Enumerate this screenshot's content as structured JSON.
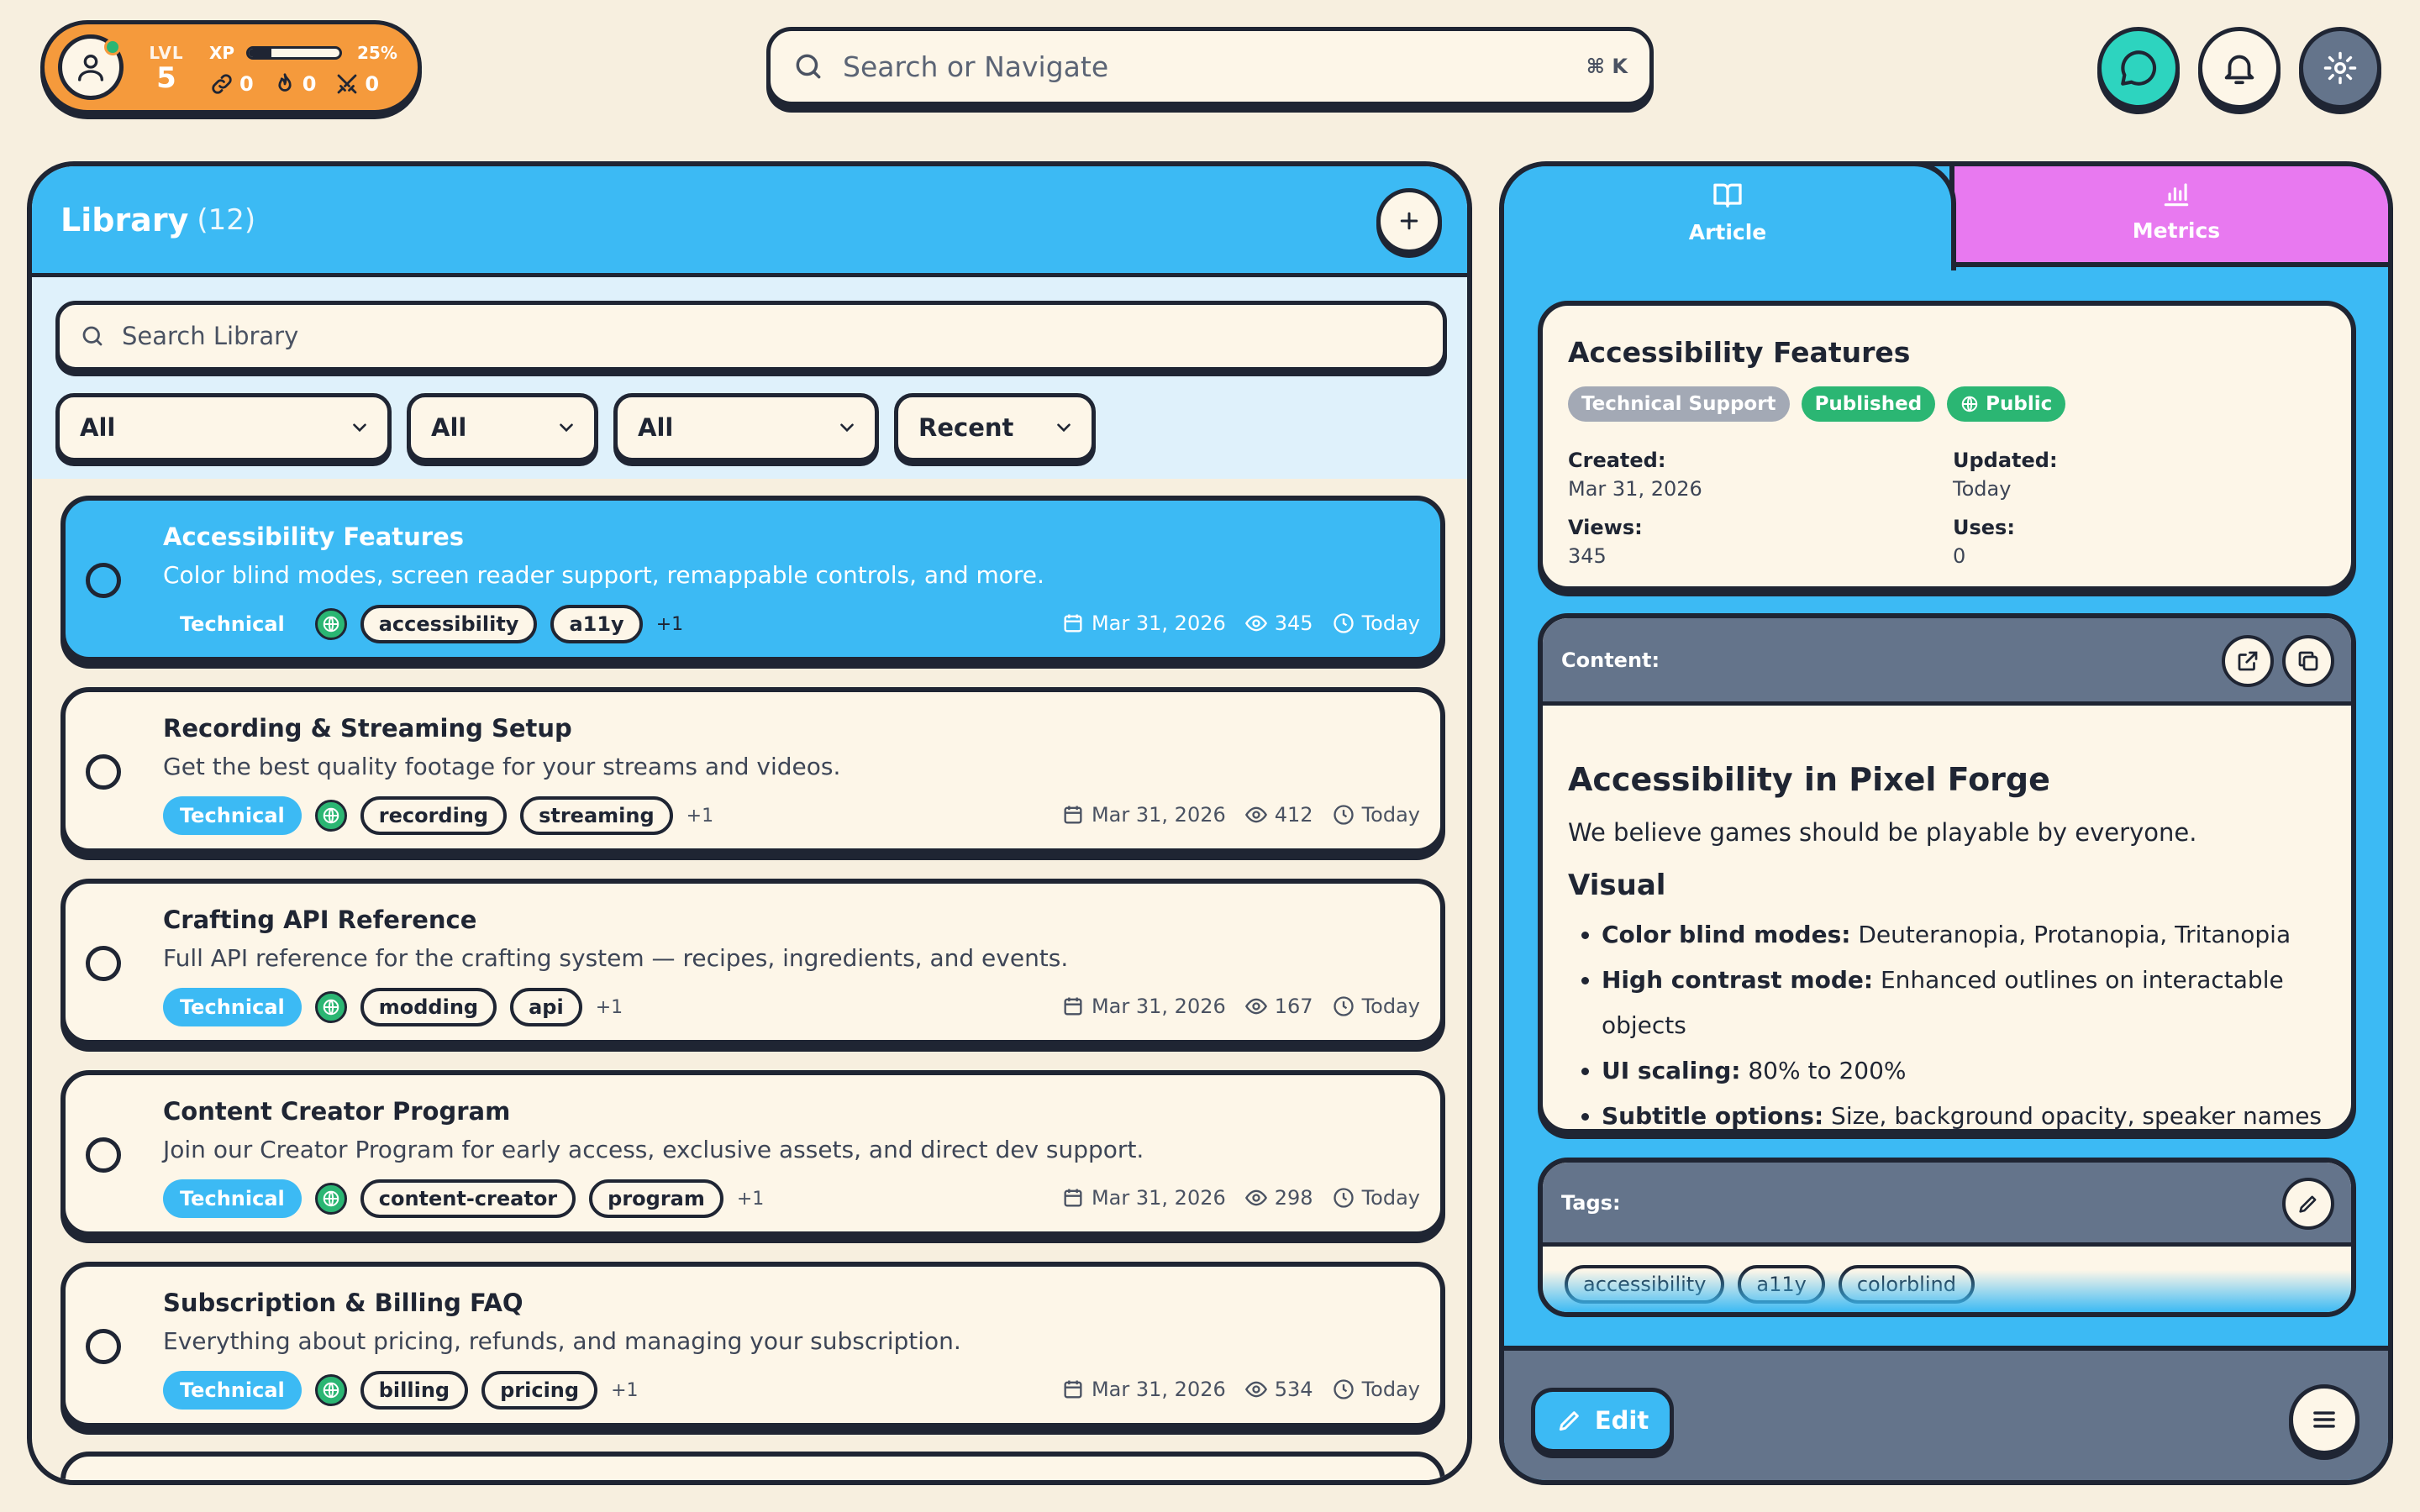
{
  "profile": {
    "level_label": "LVL",
    "level": "5",
    "xp_label": "XP",
    "xp_percent": "25%",
    "xp_fraction": 0.25,
    "stat_links": "0",
    "stat_streak": "0",
    "stat_battles": "0"
  },
  "search": {
    "placeholder": "Search or Navigate",
    "shortcut": "⌘ K"
  },
  "library": {
    "title": "Library",
    "count": "(12)",
    "search_placeholder": "Search Library",
    "filters": [
      "All",
      "All",
      "All",
      "Recent"
    ],
    "items": [
      {
        "title": "Accessibility Features",
        "description": "Color blind modes, screen reader support, remappable controls, and more.",
        "category": "Technical",
        "tags": [
          "accessibility",
          "a11y"
        ],
        "more": "+1",
        "date": "Mar 31, 2026",
        "views": "345",
        "updated": "Today"
      },
      {
        "title": "Recording & Streaming Setup",
        "description": "Get the best quality footage for your streams and videos.",
        "category": "Technical",
        "tags": [
          "recording",
          "streaming"
        ],
        "more": "+1",
        "date": "Mar 31, 2026",
        "views": "412",
        "updated": "Today"
      },
      {
        "title": "Crafting API Reference",
        "description": "Full API reference for the crafting system — recipes, ingredients, and events.",
        "category": "Technical",
        "tags": [
          "modding",
          "api"
        ],
        "more": "+1",
        "date": "Mar 31, 2026",
        "views": "167",
        "updated": "Today"
      },
      {
        "title": "Content Creator Program",
        "description": "Join our Creator Program for early access, exclusive assets, and direct dev support.",
        "category": "Technical",
        "tags": [
          "content-creator",
          "program"
        ],
        "more": "+1",
        "date": "Mar 31, 2026",
        "views": "298",
        "updated": "Today"
      },
      {
        "title": "Subscription & Billing FAQ",
        "description": "Everything about pricing, refunds, and managing your subscription.",
        "category": "Technical",
        "tags": [
          "billing",
          "pricing"
        ],
        "more": "+1",
        "date": "Mar 31, 2026",
        "views": "534",
        "updated": "Today"
      }
    ]
  },
  "detail": {
    "tab_article": "Article",
    "tab_metrics": "Metrics",
    "title": "Accessibility Features",
    "badge_category": "Technical Support",
    "badge_status": "Published",
    "badge_visibility": "Public",
    "created_label": "Created:",
    "created_value": "Mar 31, 2026",
    "updated_label": "Updated:",
    "updated_value": "Today",
    "views_label": "Views:",
    "views_value": "345",
    "uses_label": "Uses:",
    "uses_value": "0",
    "content_label": "Content:",
    "article_heading": "Accessibility in Pixel Forge",
    "article_intro": "We believe games should be playable by everyone.",
    "article_subheading": "Visual",
    "article_list": [
      {
        "term": "Color blind modes:",
        "text": " Deuteranopia, Protanopia, Tritanopia"
      },
      {
        "term": "High contrast mode:",
        "text": " Enhanced outlines on interactable objects"
      },
      {
        "term": "UI scaling:",
        "text": " 80% to 200%"
      },
      {
        "term": "Subtitle options:",
        "text": " Size, background opacity, speaker names"
      }
    ],
    "tags_label": "Tags:",
    "tags": [
      "accessibility",
      "a11y",
      "colorblind"
    ],
    "edit_label": "Edit"
  },
  "colors": {
    "background": "#f7efdf",
    "primary_blue": "#3cbaf4",
    "accent_orange": "#f59a3c",
    "metrics_pink": "#e879f0",
    "teal_chat": "#2dd4bf",
    "slate": "#64748b",
    "success_green": "#2bb673",
    "ink": "#1f2533"
  },
  "icons": [
    "user-icon",
    "link-icon",
    "flame-icon",
    "swords-icon",
    "search-icon",
    "chat-icon",
    "bell-icon",
    "gear-icon",
    "plus-icon",
    "chevron-down-icon",
    "globe-icon",
    "calendar-icon",
    "eye-icon",
    "clock-icon",
    "book-icon",
    "bar-chart-icon",
    "external-link-icon",
    "copy-icon",
    "pencil-icon",
    "menu-icon"
  ]
}
